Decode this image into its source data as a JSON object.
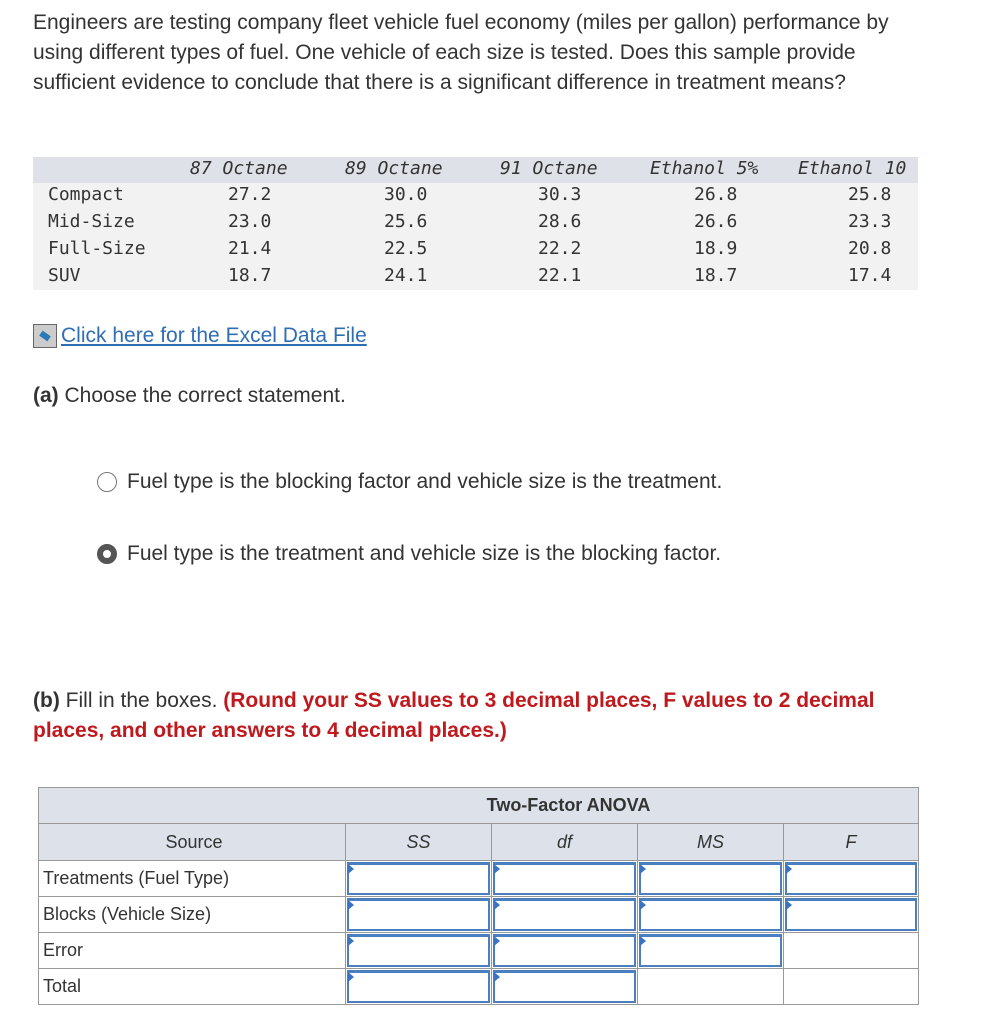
{
  "question": "Engineers are testing company fleet vehicle fuel economy (miles per gallon) performance by using different types of fuel. One vehicle of each size is tested. Does this sample provide sufficient evidence to conclude that there is a significant difference in treatment means?",
  "data_table": {
    "columns": [
      "87 Octane",
      "89 Octane",
      "91 Octane",
      "Ethanol 5%",
      "Ethanol 10"
    ],
    "rows": [
      {
        "label": "Compact",
        "values": [
          "27.2",
          "30.0",
          "30.3",
          "26.8",
          "25.8"
        ]
      },
      {
        "label": "Mid-Size",
        "values": [
          "23.0",
          "25.6",
          "28.6",
          "26.6",
          "23.3"
        ]
      },
      {
        "label": "Full-Size",
        "values": [
          "21.4",
          "22.5",
          "22.2",
          "18.9",
          "20.8"
        ]
      },
      {
        "label": "SUV",
        "values": [
          "18.7",
          "24.1",
          "22.1",
          "18.7",
          "17.4"
        ]
      }
    ]
  },
  "excel_link": "Click here for the Excel Data File",
  "part_a": {
    "label": "(a)",
    "prompt": "Choose the correct statement.",
    "options": [
      {
        "text": "Fuel type is the blocking factor and vehicle size is the treatment.",
        "selected": false
      },
      {
        "text": "Fuel type is the treatment and vehicle size is the blocking factor.",
        "selected": true
      }
    ]
  },
  "part_b": {
    "label": "(b)",
    "prompt": "Fill in the boxes.",
    "instruction": "(Round your SS values to 3 decimal places, F values to 2 decimal places, and other answers to 4 decimal places.)"
  },
  "anova": {
    "title": "Two-Factor ANOVA",
    "headers": [
      "Source",
      "SS",
      "df",
      "MS",
      "F"
    ],
    "rows": [
      "Treatments (Fuel Type)",
      "Blocks (Vehicle Size)",
      "Error",
      "Total"
    ]
  },
  "colors": {
    "link": "#2f6eb5",
    "instruction": "#c0191d",
    "input_border": "#4b7fbf"
  }
}
